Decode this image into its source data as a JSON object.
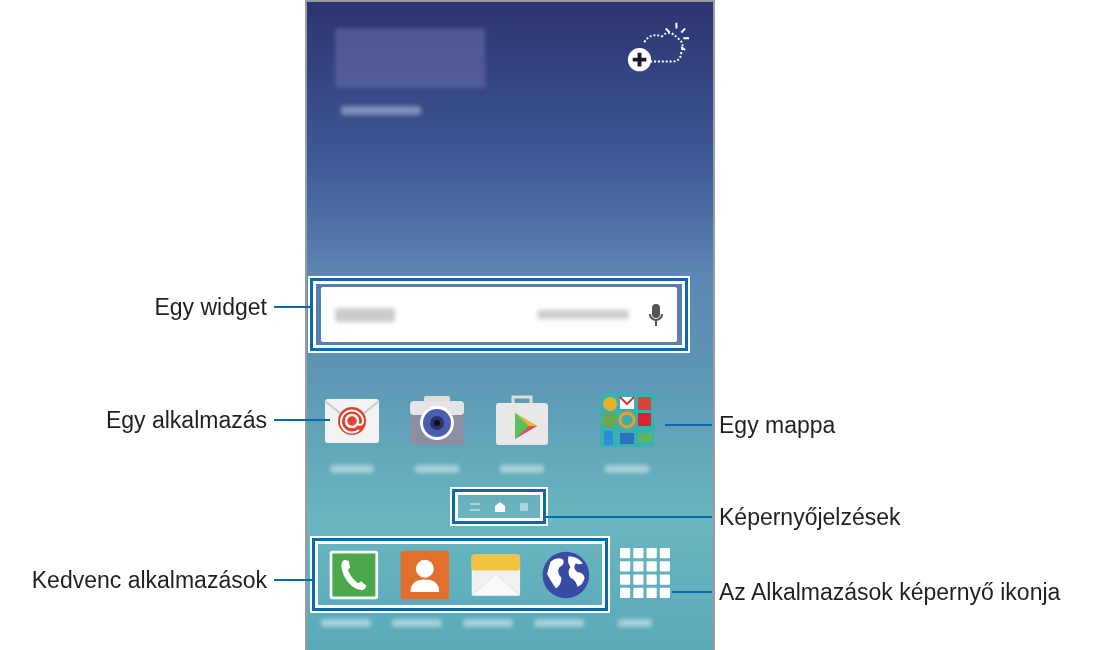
{
  "phone": {
    "apps": [
      {
        "kind": "email"
      },
      {
        "kind": "camera"
      },
      {
        "kind": "store"
      },
      {
        "kind": "folder"
      }
    ],
    "page_indicators": [
      {
        "kind": "briefing",
        "selected": false
      },
      {
        "kind": "home",
        "selected": true
      },
      {
        "kind": "page",
        "selected": false
      }
    ],
    "dock": [
      {
        "kind": "phone"
      },
      {
        "kind": "contacts"
      },
      {
        "kind": "messages"
      },
      {
        "kind": "internet"
      }
    ]
  },
  "callouts": [
    {
      "text": "Egy widget",
      "kind": "widget"
    },
    {
      "text": "Egy alkalmazás",
      "kind": "app"
    },
    {
      "text": "Egy mappa",
      "kind": "folder"
    },
    {
      "text": "Képernyőjelzések",
      "kind": "indicators"
    },
    {
      "text": "Kedvenc alkalmazások",
      "kind": "favorites"
    },
    {
      "text": "Az Alkalmazások képernyő ikonja",
      "kind": "apps_icon"
    }
  ]
}
